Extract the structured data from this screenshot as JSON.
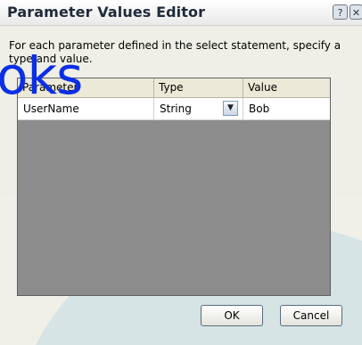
{
  "dialog": {
    "title": "Parameter Values Editor",
    "help_glyph": "?",
    "close_glyph": "✕",
    "instructions": "For each parameter defined in the select statement, specify a type and value."
  },
  "grid": {
    "columns": [
      "Parameter",
      "Type",
      "Value"
    ],
    "rows": [
      {
        "parameter": "UserName",
        "type": "String",
        "value": "Bob"
      }
    ],
    "dropdown_glyph": "▼"
  },
  "buttons": {
    "ok": "OK",
    "cancel": "Cancel"
  },
  "watermark": {
    "logo_text": "oks"
  },
  "colors": {
    "logo_blue": "#0b2fe6",
    "grid_bg": "#8c8c8c",
    "dialog_bg": "#efefe7"
  },
  "icons": [
    "help-icon",
    "close-icon",
    "chevron-down-icon"
  ]
}
